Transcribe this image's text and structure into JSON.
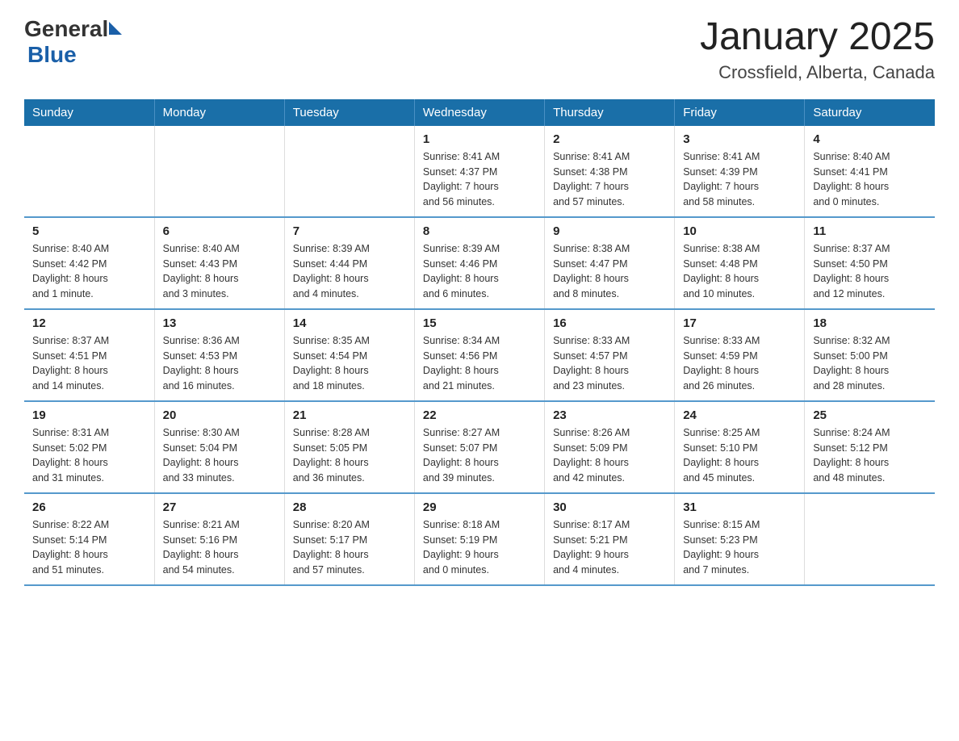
{
  "logo": {
    "text_general": "General",
    "text_blue": "Blue"
  },
  "title": "January 2025",
  "subtitle": "Crossfield, Alberta, Canada",
  "weekdays": [
    "Sunday",
    "Monday",
    "Tuesday",
    "Wednesday",
    "Thursday",
    "Friday",
    "Saturday"
  ],
  "weeks": [
    [
      {
        "day": "",
        "info": ""
      },
      {
        "day": "",
        "info": ""
      },
      {
        "day": "",
        "info": ""
      },
      {
        "day": "1",
        "info": "Sunrise: 8:41 AM\nSunset: 4:37 PM\nDaylight: 7 hours\nand 56 minutes."
      },
      {
        "day": "2",
        "info": "Sunrise: 8:41 AM\nSunset: 4:38 PM\nDaylight: 7 hours\nand 57 minutes."
      },
      {
        "day": "3",
        "info": "Sunrise: 8:41 AM\nSunset: 4:39 PM\nDaylight: 7 hours\nand 58 minutes."
      },
      {
        "day": "4",
        "info": "Sunrise: 8:40 AM\nSunset: 4:41 PM\nDaylight: 8 hours\nand 0 minutes."
      }
    ],
    [
      {
        "day": "5",
        "info": "Sunrise: 8:40 AM\nSunset: 4:42 PM\nDaylight: 8 hours\nand 1 minute."
      },
      {
        "day": "6",
        "info": "Sunrise: 8:40 AM\nSunset: 4:43 PM\nDaylight: 8 hours\nand 3 minutes."
      },
      {
        "day": "7",
        "info": "Sunrise: 8:39 AM\nSunset: 4:44 PM\nDaylight: 8 hours\nand 4 minutes."
      },
      {
        "day": "8",
        "info": "Sunrise: 8:39 AM\nSunset: 4:46 PM\nDaylight: 8 hours\nand 6 minutes."
      },
      {
        "day": "9",
        "info": "Sunrise: 8:38 AM\nSunset: 4:47 PM\nDaylight: 8 hours\nand 8 minutes."
      },
      {
        "day": "10",
        "info": "Sunrise: 8:38 AM\nSunset: 4:48 PM\nDaylight: 8 hours\nand 10 minutes."
      },
      {
        "day": "11",
        "info": "Sunrise: 8:37 AM\nSunset: 4:50 PM\nDaylight: 8 hours\nand 12 minutes."
      }
    ],
    [
      {
        "day": "12",
        "info": "Sunrise: 8:37 AM\nSunset: 4:51 PM\nDaylight: 8 hours\nand 14 minutes."
      },
      {
        "day": "13",
        "info": "Sunrise: 8:36 AM\nSunset: 4:53 PM\nDaylight: 8 hours\nand 16 minutes."
      },
      {
        "day": "14",
        "info": "Sunrise: 8:35 AM\nSunset: 4:54 PM\nDaylight: 8 hours\nand 18 minutes."
      },
      {
        "day": "15",
        "info": "Sunrise: 8:34 AM\nSunset: 4:56 PM\nDaylight: 8 hours\nand 21 minutes."
      },
      {
        "day": "16",
        "info": "Sunrise: 8:33 AM\nSunset: 4:57 PM\nDaylight: 8 hours\nand 23 minutes."
      },
      {
        "day": "17",
        "info": "Sunrise: 8:33 AM\nSunset: 4:59 PM\nDaylight: 8 hours\nand 26 minutes."
      },
      {
        "day": "18",
        "info": "Sunrise: 8:32 AM\nSunset: 5:00 PM\nDaylight: 8 hours\nand 28 minutes."
      }
    ],
    [
      {
        "day": "19",
        "info": "Sunrise: 8:31 AM\nSunset: 5:02 PM\nDaylight: 8 hours\nand 31 minutes."
      },
      {
        "day": "20",
        "info": "Sunrise: 8:30 AM\nSunset: 5:04 PM\nDaylight: 8 hours\nand 33 minutes."
      },
      {
        "day": "21",
        "info": "Sunrise: 8:28 AM\nSunset: 5:05 PM\nDaylight: 8 hours\nand 36 minutes."
      },
      {
        "day": "22",
        "info": "Sunrise: 8:27 AM\nSunset: 5:07 PM\nDaylight: 8 hours\nand 39 minutes."
      },
      {
        "day": "23",
        "info": "Sunrise: 8:26 AM\nSunset: 5:09 PM\nDaylight: 8 hours\nand 42 minutes."
      },
      {
        "day": "24",
        "info": "Sunrise: 8:25 AM\nSunset: 5:10 PM\nDaylight: 8 hours\nand 45 minutes."
      },
      {
        "day": "25",
        "info": "Sunrise: 8:24 AM\nSunset: 5:12 PM\nDaylight: 8 hours\nand 48 minutes."
      }
    ],
    [
      {
        "day": "26",
        "info": "Sunrise: 8:22 AM\nSunset: 5:14 PM\nDaylight: 8 hours\nand 51 minutes."
      },
      {
        "day": "27",
        "info": "Sunrise: 8:21 AM\nSunset: 5:16 PM\nDaylight: 8 hours\nand 54 minutes."
      },
      {
        "day": "28",
        "info": "Sunrise: 8:20 AM\nSunset: 5:17 PM\nDaylight: 8 hours\nand 57 minutes."
      },
      {
        "day": "29",
        "info": "Sunrise: 8:18 AM\nSunset: 5:19 PM\nDaylight: 9 hours\nand 0 minutes."
      },
      {
        "day": "30",
        "info": "Sunrise: 8:17 AM\nSunset: 5:21 PM\nDaylight: 9 hours\nand 4 minutes."
      },
      {
        "day": "31",
        "info": "Sunrise: 8:15 AM\nSunset: 5:23 PM\nDaylight: 9 hours\nand 7 minutes."
      },
      {
        "day": "",
        "info": ""
      }
    ]
  ]
}
